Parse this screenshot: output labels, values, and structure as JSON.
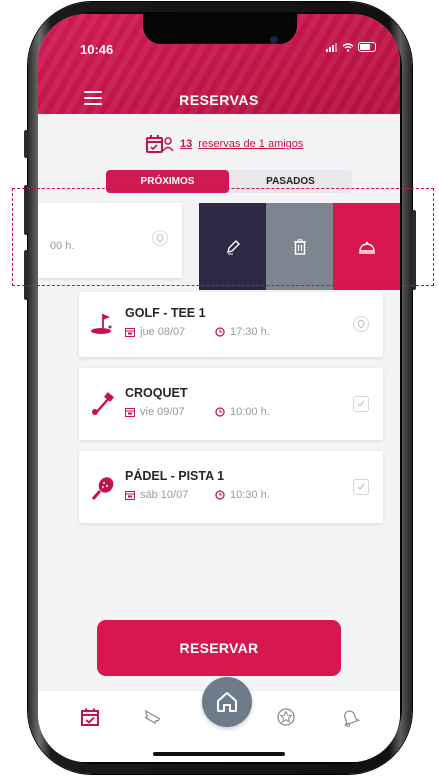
{
  "status_bar": {
    "time": "10:46"
  },
  "header": {
    "title": "RESERVAS"
  },
  "friends_link": {
    "count": "13",
    "text": "reservas de 1 amigos"
  },
  "tabs": [
    {
      "label": "PRÓXIMOS",
      "active": true
    },
    {
      "label": "PASADOS",
      "active": false
    }
  ],
  "swiped_card": {
    "partial_time": "00 h.",
    "actions": [
      {
        "name": "edit",
        "color": "#2b2943",
        "icon": "pencil-icon"
      },
      {
        "name": "delete",
        "color": "#7d8690",
        "icon": "trash-icon"
      },
      {
        "name": "service",
        "color": "#d8174f",
        "icon": "bell-icon"
      }
    ]
  },
  "reservations": [
    {
      "name": "GOLF - TEE 1",
      "date": "jue 08/07",
      "time": "17:30 h.",
      "icon": "golf-icon",
      "status_icon": "location-icon"
    },
    {
      "name": "CROQUET",
      "date": "vie 09/07",
      "time": "10:00 h.",
      "icon": "croquet-icon",
      "status_icon": "check-icon"
    },
    {
      "name": "PÁDEL - PISTA 1",
      "date": "sáb 10/07",
      "time": "10:30 h.",
      "icon": "padel-icon",
      "status_icon": "check-icon"
    }
  ],
  "cta": {
    "label": "RESERVAR"
  },
  "tabbar": [
    "calendar-icon",
    "ticket-icon",
    "home-icon",
    "badge-icon",
    "bell-icon"
  ],
  "colors": {
    "brand": "#d8174f",
    "dark": "#2b2943",
    "gray": "#7d8690"
  }
}
